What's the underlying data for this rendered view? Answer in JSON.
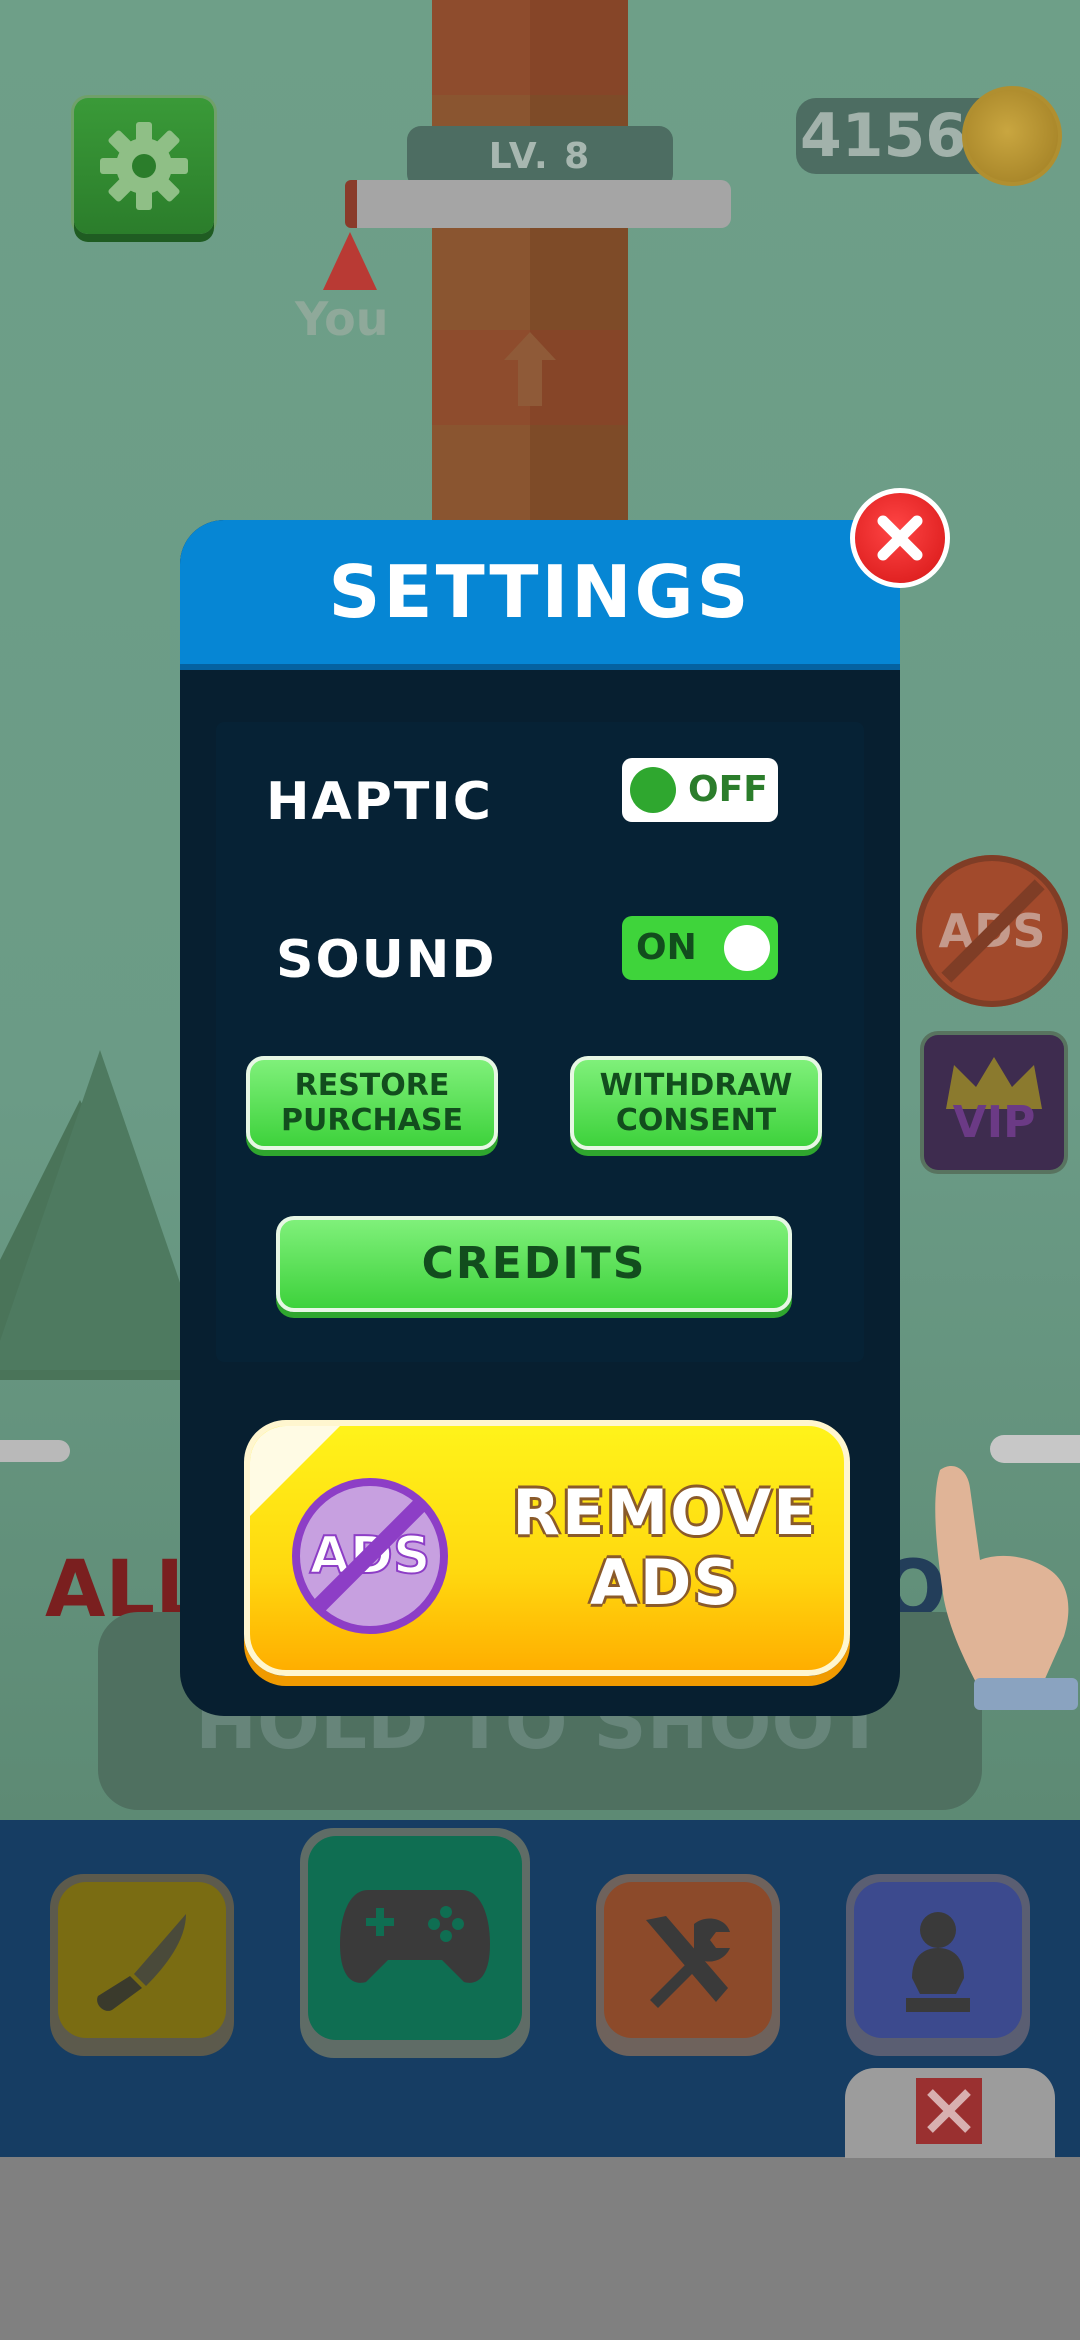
{
  "game": {
    "level_label": "LV. 8",
    "level_progress": 0.03,
    "you_label": "You",
    "coins": "4156",
    "bg_text_left": "ALL",
    "bg_text_right": "OU",
    "hold_text": "HOLD TO SHOOT",
    "side_ads_label": "ADS",
    "vip_label": "VIP"
  },
  "settings": {
    "title": "SETTINGS",
    "haptic": {
      "label": "HAPTIC",
      "state": "OFF"
    },
    "sound": {
      "label": "SOUND",
      "state": "ON"
    },
    "restore_line1": "RESTORE",
    "restore_line2": "PURCHASE",
    "withdraw_line1": "WITHDRAW",
    "withdraw_line2": "CONSENT",
    "credits": "CREDITS",
    "remove_ads_line1": "REMOVE",
    "remove_ads_line2": "ADS",
    "ads_badge": "ADS"
  },
  "bottom_nav": {
    "items": [
      {
        "icon": "knife-icon",
        "color": "#7a6c12"
      },
      {
        "icon": "gamepad-icon",
        "color": "#0f6e52",
        "active": true
      },
      {
        "icon": "tools-icon",
        "color": "#8c4a2a"
      },
      {
        "icon": "statue-icon",
        "color": "#3c4a8e"
      }
    ]
  },
  "colors": {
    "accent_blue": "#0686d4",
    "green_button": "#48d845",
    "close_red": "#e02020",
    "remove_ads_yellow": "#ffd80f"
  }
}
